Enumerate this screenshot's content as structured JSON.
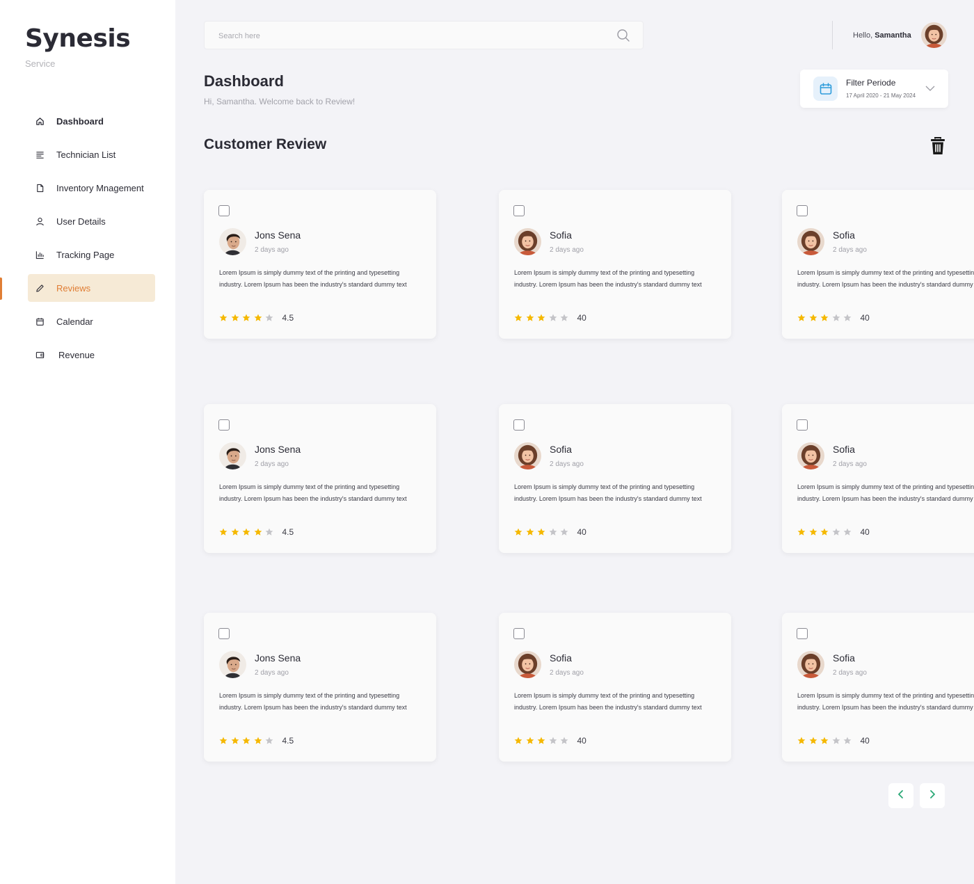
{
  "brand": {
    "name": "Synesis",
    "subtitle": "Service"
  },
  "sidebar": {
    "items": [
      {
        "label": "Dashboard",
        "icon": "home-icon"
      },
      {
        "label": "Technician List",
        "icon": "list-icon"
      },
      {
        "label": "Inventory Mnagement",
        "icon": "file-icon"
      },
      {
        "label": "User Details",
        "icon": "user-icon"
      },
      {
        "label": "Tracking Page",
        "icon": "bar-chart-icon"
      },
      {
        "label": "Reviews",
        "icon": "pencil-icon"
      },
      {
        "label": "Calendar",
        "icon": "calendar-icon"
      },
      {
        "label": "Revenue",
        "icon": "wallet-icon"
      }
    ],
    "active_item": "Reviews"
  },
  "search": {
    "placeholder": "Search here",
    "value": ""
  },
  "user": {
    "greeting": "Hello,",
    "name": "Samantha"
  },
  "header": {
    "title": "Dashboard",
    "subtitle": "Hi, Samantha. Welcome back  to  Review!"
  },
  "filter": {
    "title": "Filter Periode",
    "range": "17 April 2020 - 21 May 2024"
  },
  "section": {
    "title": "Customer Review"
  },
  "reviews": [
    {
      "name": "Jons Sena",
      "time": "2 days ago",
      "text": "Lorem Ipsum is simply dummy text of the printing and typesetting industry. Lorem Ipsum has been the industry's standard dummy text",
      "stars": 4,
      "rating": "4.5",
      "avatar": "male"
    },
    {
      "name": "Sofia",
      "time": "2 days ago",
      "text": "Lorem Ipsum is simply dummy text of the printing and typesetting industry. Lorem Ipsum has been the industry's standard dummy text",
      "stars": 3,
      "rating": "40",
      "avatar": "female"
    },
    {
      "name": "Sofia",
      "time": "2 days ago",
      "text": "Lorem Ipsum is simply dummy text of the printing and typesetting industry. Lorem Ipsum has been the industry's standard dummy text",
      "stars": 3,
      "rating": "40",
      "avatar": "female"
    },
    {
      "name": "Jons Sena",
      "time": "2 days ago",
      "text": "Lorem Ipsum is simply dummy text of the printing and typesetting industry. Lorem Ipsum has been the industry's standard dummy text",
      "stars": 4,
      "rating": "4.5",
      "avatar": "male"
    },
    {
      "name": "Sofia",
      "time": "2 days ago",
      "text": "Lorem Ipsum is simply dummy text of the printing and typesetting industry. Lorem Ipsum has been the industry's standard dummy text",
      "stars": 3,
      "rating": "40",
      "avatar": "female"
    },
    {
      "name": "Sofia",
      "time": "2 days ago",
      "text": "Lorem Ipsum is simply dummy text of the printing and typesetting industry. Lorem Ipsum has been the industry's standard dummy text",
      "stars": 3,
      "rating": "40",
      "avatar": "female"
    },
    {
      "name": "Jons Sena",
      "time": "2 days ago",
      "text": "Lorem Ipsum is simply dummy text of the printing and typesetting industry. Lorem Ipsum has been the industry's standard dummy text",
      "stars": 4,
      "rating": "4.5",
      "avatar": "male"
    },
    {
      "name": "Sofia",
      "time": "2 days ago",
      "text": "Lorem Ipsum is simply dummy text of the printing and typesetting industry. Lorem Ipsum has been the industry's standard dummy text",
      "stars": 3,
      "rating": "40",
      "avatar": "female"
    },
    {
      "name": "Sofia",
      "time": "2 days ago",
      "text": "Lorem Ipsum is simply dummy text of the printing and typesetting industry. Lorem Ipsum has been the industry's standard dummy text",
      "stars": 3,
      "rating": "40",
      "avatar": "female"
    }
  ],
  "pagination": {
    "prev_icon": "chevron-left-icon",
    "next_icon": "chevron-right-icon"
  },
  "colors": {
    "accent": "#e07e35",
    "accent_bg": "#f6ead6",
    "star": "#f5b800",
    "star_empty": "#c4c4c8",
    "pagination": "#2aa876",
    "calendar": "#2d9cdb"
  }
}
